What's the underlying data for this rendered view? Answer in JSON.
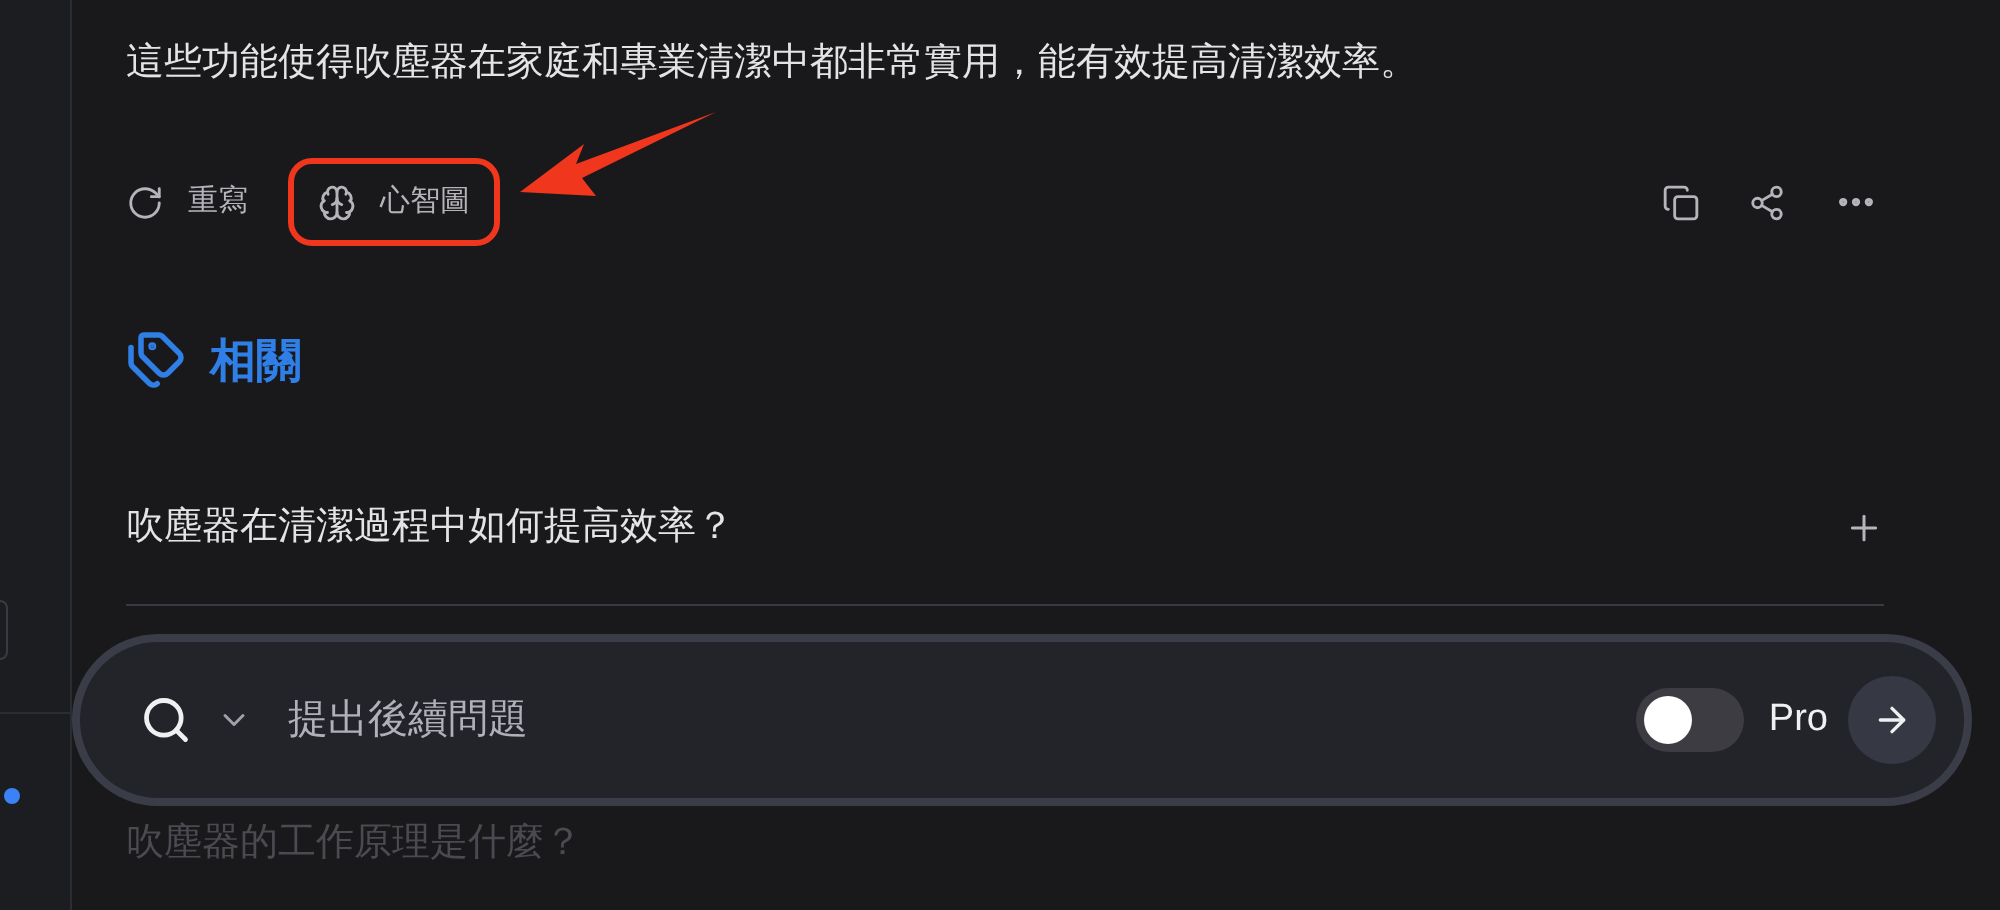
{
  "answer": {
    "text": "這些功能使得吹塵器在家庭和專業清潔中都非常實用，能有效提高清潔效率。"
  },
  "actions": [
    {
      "kind": "rewrite",
      "label": "重寫",
      "highlighted": false
    },
    {
      "kind": "mindmap",
      "label": "心智圖",
      "highlighted": true
    }
  ],
  "related": {
    "title": "相關",
    "questions": [
      "吹塵器在清潔過程中如何提高效率？",
      "吹塵器的工作原理是什麼？"
    ]
  },
  "composer": {
    "placeholder": "提出後續問題",
    "pro_toggle": {
      "label": "Pro",
      "on": false
    }
  }
}
